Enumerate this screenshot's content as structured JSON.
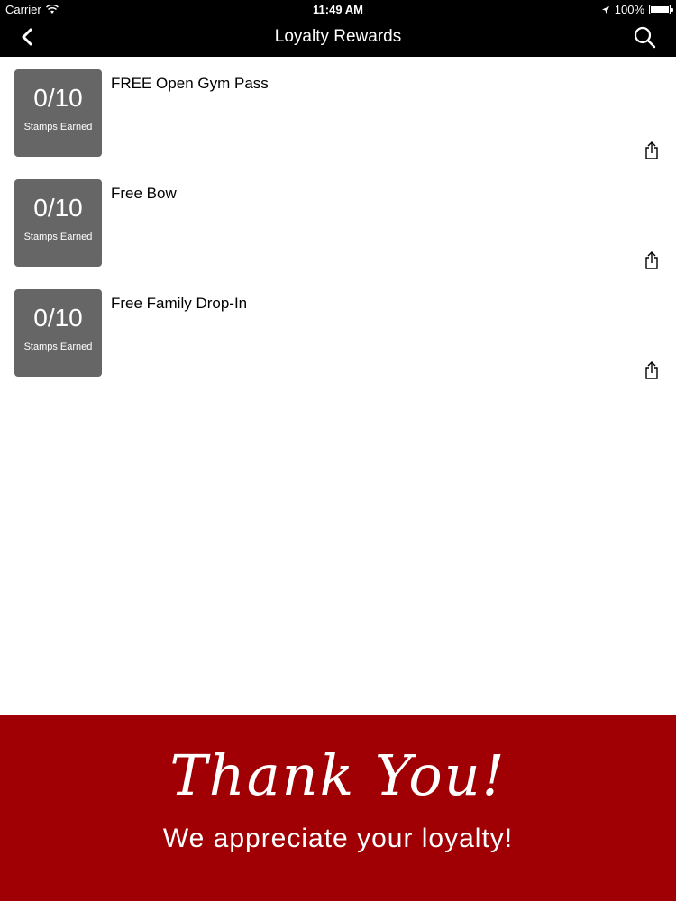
{
  "status_bar": {
    "carrier": "Carrier",
    "time": "11:49 AM",
    "battery": "100%",
    "battery_level": 1.0
  },
  "nav": {
    "title": "Loyalty Rewards",
    "back_icon": "chevron-left-icon",
    "search_icon": "search-icon"
  },
  "rewards": [
    {
      "title": "FREE Open Gym Pass",
      "count": "0/10",
      "label": "Stamps Earned"
    },
    {
      "title": "Free Bow",
      "count": "0/10",
      "label": "Stamps Earned"
    },
    {
      "title": "Free Family Drop-In",
      "count": "0/10",
      "label": "Stamps Earned"
    }
  ],
  "banner": {
    "title": "Thank You!",
    "subtitle": "We appreciate your loyalty!",
    "color": "#a00003"
  },
  "colors": {
    "stamp_box": "#666666",
    "bar": "#000000"
  }
}
